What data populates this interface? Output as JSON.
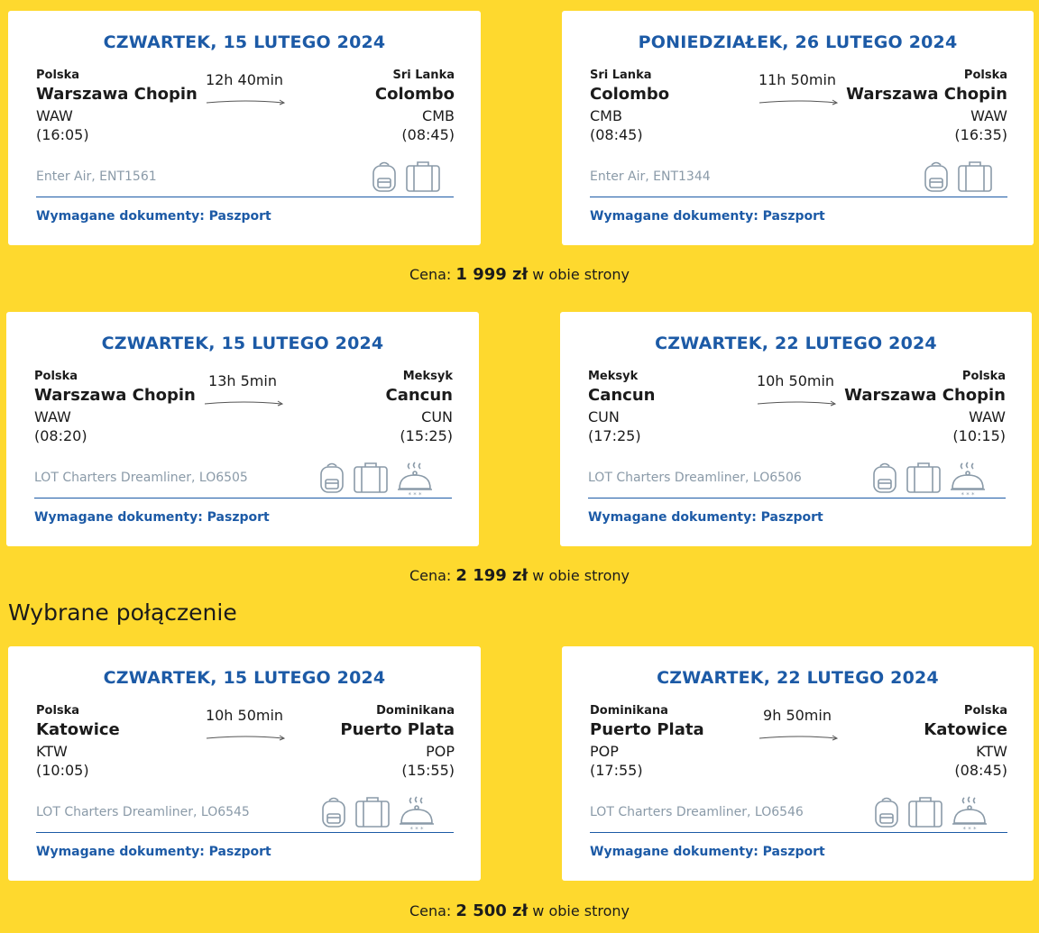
{
  "groups": [
    {
      "price_prefix": "Cena:",
      "price_value": "1 999 zł",
      "price_suffix": "w obie strony",
      "flights": [
        {
          "date": "CZWARTEK, 15 LUTEGO 2024",
          "from_country": "Polska",
          "from_city": "Warszawa Chopin",
          "from_code": "WAW",
          "from_time": "(16:05)",
          "duration": "12h 40min",
          "to_country": "Sri Lanka",
          "to_city": "Colombo",
          "to_code": "CMB",
          "to_time": "(08:45)",
          "airline": "Enter Air, ENT1561",
          "docs": "Wymagane dokumenty: Paszport",
          "icons": [
            "backpack-icon",
            "suitcase-icon"
          ]
        },
        {
          "date": "PONIEDZIAŁEK, 26 LUTEGO 2024",
          "from_country": "Sri Lanka",
          "from_city": "Colombo",
          "from_code": "CMB",
          "from_time": "(08:45)",
          "duration": "11h 50min",
          "to_country": "Polska",
          "to_city": "Warszawa Chopin",
          "to_code": "WAW",
          "to_time": "(16:35)",
          "airline": "Enter Air, ENT1344",
          "docs": "Wymagane dokumenty: Paszport",
          "icons": [
            "backpack-icon",
            "suitcase-icon"
          ]
        }
      ]
    },
    {
      "price_prefix": "Cena:",
      "price_value": "2 199 zł",
      "price_suffix": "w obie strony",
      "flights": [
        {
          "date": "CZWARTEK, 15 LUTEGO 2024",
          "from_country": "Polska",
          "from_city": "Warszawa Chopin",
          "from_code": "WAW",
          "from_time": "(08:20)",
          "duration": "13h 5min",
          "to_country": "Meksyk",
          "to_city": "Cancun",
          "to_code": "CUN",
          "to_time": "(15:25)",
          "airline": "LOT Charters Dreamliner, LO6505",
          "docs": "Wymagane dokumenty: Paszport",
          "icons": [
            "backpack-icon",
            "suitcase-icon",
            "meal-icon"
          ]
        },
        {
          "date": "CZWARTEK, 22 LUTEGO 2024",
          "from_country": "Meksyk",
          "from_city": "Cancun",
          "from_code": "CUN",
          "from_time": "(17:25)",
          "duration": "10h 50min",
          "to_country": "Polska",
          "to_city": "Warszawa Chopin",
          "to_code": "WAW",
          "to_time": "(10:15)",
          "airline": "LOT Charters Dreamliner, LO6506",
          "docs": "Wymagane dokumenty: Paszport",
          "icons": [
            "backpack-icon",
            "suitcase-icon",
            "meal-icon"
          ]
        }
      ]
    },
    {
      "price_prefix": "Cena:",
      "price_value": "2 500 zł",
      "price_suffix": "w obie strony",
      "flights": [
        {
          "date": "CZWARTEK, 15 LUTEGO 2024",
          "from_country": "Polska",
          "from_city": "Katowice",
          "from_code": "KTW",
          "from_time": "(10:05)",
          "duration": "10h 50min",
          "to_country": "Dominikana",
          "to_city": "Puerto Plata",
          "to_code": "POP",
          "to_time": "(15:55)",
          "airline": "LOT Charters Dreamliner, LO6545",
          "docs": "Wymagane dokumenty: Paszport",
          "icons": [
            "backpack-icon",
            "suitcase-icon",
            "meal-icon"
          ]
        },
        {
          "date": "CZWARTEK, 22 LUTEGO 2024",
          "from_country": "Dominikana",
          "from_city": "Puerto Plata",
          "from_code": "POP",
          "from_time": "(17:55)",
          "duration": "9h 50min",
          "to_country": "Polska",
          "to_city": "Katowice",
          "to_code": "KTW",
          "to_time": "(08:45)",
          "airline": "LOT Charters Dreamliner, LO6546",
          "docs": "Wymagane dokumenty: Paszport",
          "icons": [
            "backpack-icon",
            "suitcase-icon",
            "meal-icon"
          ]
        }
      ]
    }
  ],
  "selected_title": "Wybrane połączenie",
  "colors": {
    "background": "#fed92e",
    "accent": "#1c5aa6",
    "muted": "#8a9aa8",
    "icon": "#8a9aa8"
  }
}
